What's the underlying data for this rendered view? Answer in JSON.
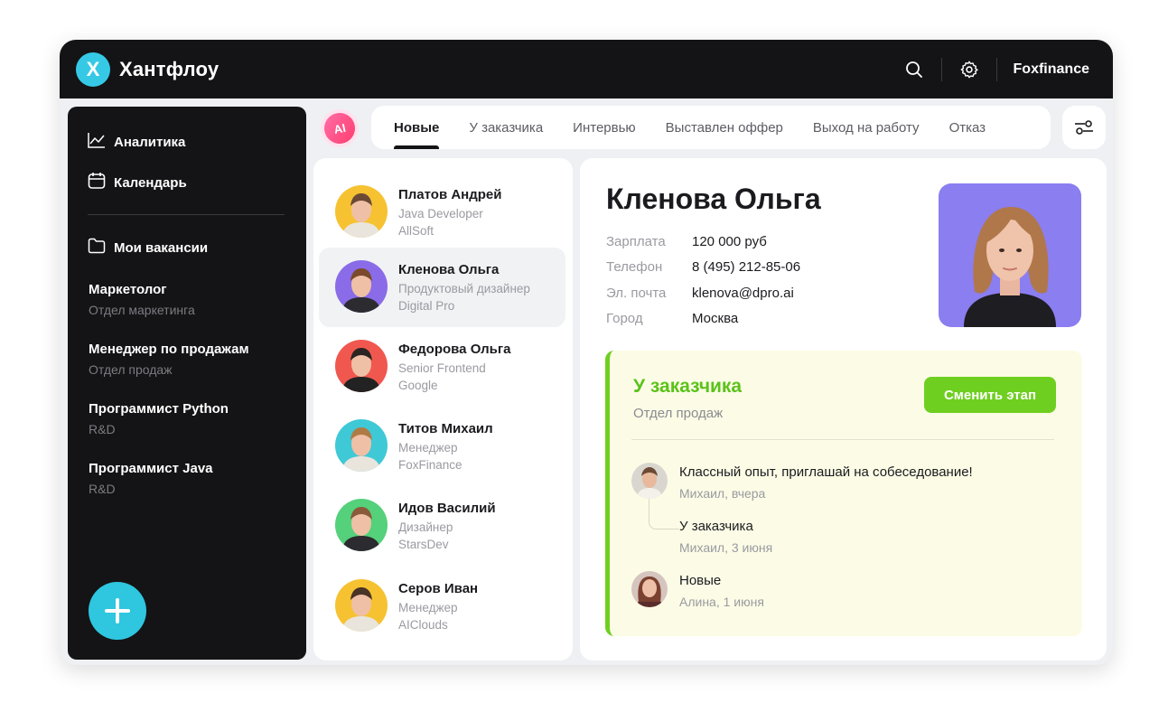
{
  "app": {
    "logo_letter": "X",
    "name": "Хантфлоу",
    "company": "Foxfinance",
    "accent": "#35c9e6"
  },
  "topbar_icons": [
    "search-icon",
    "gear-icon"
  ],
  "sidebar": {
    "links": [
      {
        "label": "Аналитика",
        "icon": "chart-icon"
      },
      {
        "label": "Календарь",
        "icon": "calendar-icon"
      },
      {
        "label": "Мои вакансии",
        "icon": "folder-icon"
      }
    ],
    "vacancies": [
      {
        "title": "Маркетолог",
        "dept": "Отдел маркетинга"
      },
      {
        "title": "Менеджер по продажам",
        "dept": "Отдел продаж"
      },
      {
        "title": "Программист Python",
        "dept": "R&D"
      },
      {
        "title": "Программист Java",
        "dept": "R&D"
      }
    ],
    "add_icon": "plus-icon"
  },
  "ai_badge": "AI",
  "tabs": [
    {
      "label": "Новые",
      "active": true
    },
    {
      "label": "У заказчика",
      "active": false
    },
    {
      "label": "Интервью",
      "active": false
    },
    {
      "label": "Выставлен оффер",
      "active": false
    },
    {
      "label": "Выход на работу",
      "active": false
    },
    {
      "label": "Отказ",
      "active": false
    }
  ],
  "candidates": [
    {
      "name": "Платов Андрей",
      "role": "Java Developer",
      "company": "AllSoft",
      "avatar_bg": "#f6c232",
      "selected": false
    },
    {
      "name": "Кленова Ольга",
      "role": "Продуктовый дизайнер",
      "company": "Digital Pro",
      "avatar_bg": "#8a6ce8",
      "selected": true
    },
    {
      "name": "Федорова Ольга",
      "role": "Senior Frontend",
      "company": "Google",
      "avatar_bg": "#f0584f",
      "selected": false
    },
    {
      "name": "Титов Михаил",
      "role": "Менеджер",
      "company": "FoxFinance",
      "avatar_bg": "#3fc9d6",
      "selected": false
    },
    {
      "name": "Идов Василий",
      "role": "Дизайнер",
      "company": "StarsDev",
      "avatar_bg": "#54d17a",
      "selected": false
    },
    {
      "name": "Серов Иван",
      "role": "Менеджер",
      "company": "AIClouds",
      "avatar_bg": "#f6c232",
      "selected": false
    }
  ],
  "detail": {
    "name": "Кленова Ольга",
    "fields": [
      {
        "key": "Зарплата",
        "value": "120 000 руб"
      },
      {
        "key": "Телефон",
        "value": "8 (495) 212-85-06"
      },
      {
        "key": "Эл. почта",
        "value": "klenova@dpro.ai"
      },
      {
        "key": "Город",
        "value": "Москва"
      }
    ],
    "photo_bg": "#8a7ef0",
    "stage": {
      "title": "У заказчика",
      "subtitle": "Отдел продаж",
      "button": "Сменить этап",
      "color": "#6fcf20",
      "events": [
        {
          "text": "Классный опыт, приглашай на собеседование!",
          "meta": "Михаил, вчера"
        },
        {
          "text": "У заказчика",
          "meta": "Михаил, 3 июня"
        },
        {
          "text": "Новые",
          "meta": "Алина, 1 июня"
        }
      ]
    }
  }
}
